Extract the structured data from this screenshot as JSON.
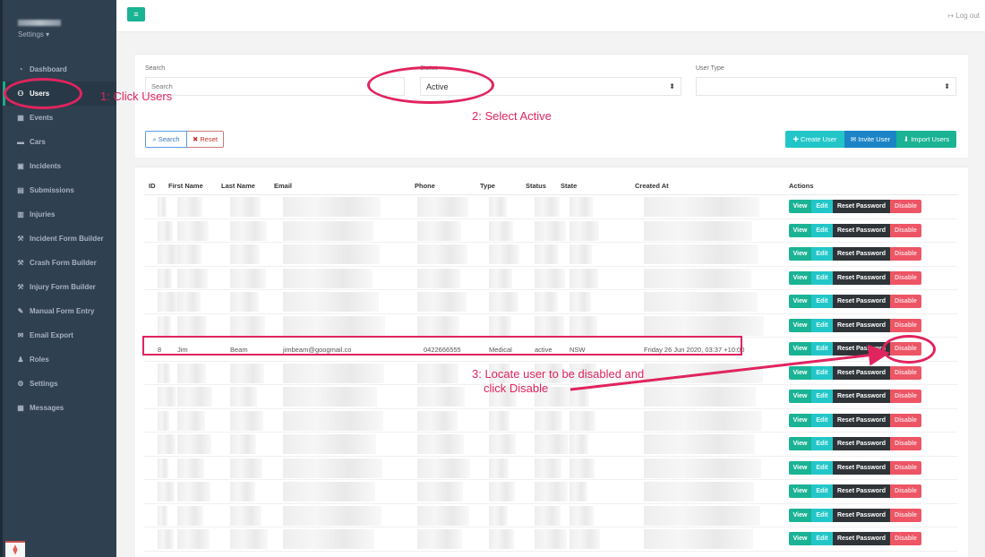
{
  "sidebar": {
    "profile_settings": "Settings ▾",
    "items": [
      {
        "label": "Dashboard",
        "icon": "tachometer-icon",
        "glyph": "◔",
        "active": false
      },
      {
        "label": "Users",
        "icon": "users-icon",
        "glyph": "⚇",
        "active": true
      },
      {
        "label": "Events",
        "icon": "calendar-icon",
        "glyph": "▦",
        "active": false
      },
      {
        "label": "Cars",
        "icon": "car-icon",
        "glyph": "▬",
        "active": false
      },
      {
        "label": "Incidents",
        "icon": "truck-icon",
        "glyph": "▣",
        "active": false
      },
      {
        "label": "Submissions",
        "icon": "file-icon",
        "glyph": "▤",
        "active": false
      },
      {
        "label": "Injuries",
        "icon": "ambulance-icon",
        "glyph": "▥",
        "active": false
      },
      {
        "label": "Incident Form Builder",
        "icon": "wrench-icon",
        "glyph": "⚒",
        "active": false
      },
      {
        "label": "Crash Form Builder",
        "icon": "wrench-icon",
        "glyph": "⚒",
        "active": false
      },
      {
        "label": "Injury Form Builder",
        "icon": "wrench-icon",
        "glyph": "⚒",
        "active": false
      },
      {
        "label": "Manual Form Entry",
        "icon": "edit-icon",
        "glyph": "✎",
        "active": false
      },
      {
        "label": "Email Export",
        "icon": "envelope-icon",
        "glyph": "✉",
        "active": false
      },
      {
        "label": "Roles",
        "icon": "user-cog-icon",
        "glyph": "♟",
        "active": false
      },
      {
        "label": "Settings",
        "icon": "gear-icon",
        "glyph": "⚙",
        "active": false
      },
      {
        "label": "Messages",
        "icon": "calendar-icon",
        "glyph": "▦",
        "active": false
      }
    ]
  },
  "topbar": {
    "menu_glyph": "≡",
    "logout_label": "↦ Log out"
  },
  "filters": {
    "search_label": "Search",
    "search_placeholder": "Search",
    "status_label": "Status",
    "status_value": "Active",
    "user_type_label": "User Type",
    "user_type_value": "",
    "caret": "⬍",
    "search_button": "⌕ Search",
    "reset_button": "✖ Reset",
    "create_user": "✚ Create User",
    "invite_user": "✉ Invite User",
    "import_users": "⬇ Import Users"
  },
  "table": {
    "headers": [
      "ID",
      "First Name",
      "Last Name",
      "Email",
      "Phone",
      "Type",
      "Status",
      "State",
      "Created At",
      "Actions"
    ],
    "highlighted_row_index": 6,
    "highlighted_row": {
      "id": "8",
      "first_name": "Jim",
      "last_name": "Beam",
      "email": "jimbeam@googmail.co",
      "phone": "0422666555",
      "type": "Medical",
      "status": "active",
      "state": "NSW",
      "created_at": "Friday 26 Jun 2020, 03:37 +10:00"
    },
    "row_count": 15,
    "actions": {
      "view": "View",
      "edit": "Edit",
      "reset_password": "Reset Password",
      "disable": "Disable"
    }
  },
  "annotations": {
    "step1": "1: Click Users",
    "step2": "2: Select Active",
    "step3_line1": "3: Locate user to be disabled and",
    "step3_line2": "click Disable"
  },
  "colors": {
    "sidebar_bg": "#2f4050",
    "primary": "#1ab394",
    "info": "#23c6c8",
    "success_blue": "#1c84c6",
    "danger": "#ed5565",
    "annotation": "#e0245e"
  }
}
